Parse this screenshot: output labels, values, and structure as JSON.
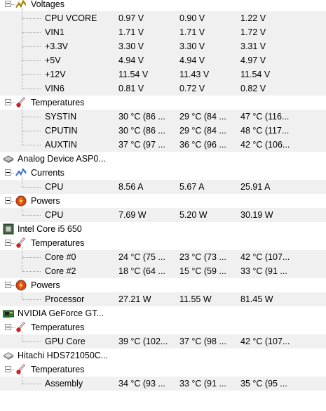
{
  "colors": {
    "row_shade": "#f0f0f0",
    "tree_line": "#a0a0a0",
    "voltage_icon": "#c8a000",
    "temperature_icon": "#cc2222",
    "current_icon": "#2a62c8",
    "power_icon": "#d94a1a"
  },
  "sections": [
    {
      "kind": "category",
      "icon": "voltage-icon",
      "label": "Voltages",
      "rows": [
        {
          "name": "CPU VCORE",
          "value": "0.97 V",
          "min": "0.90 V",
          "max": "1.22 V"
        },
        {
          "name": "VIN1",
          "value": "1.71 V",
          "min": "1.71 V",
          "max": "1.72 V"
        },
        {
          "name": "+3.3V",
          "value": "3.30 V",
          "min": "3.30 V",
          "max": "3.31 V"
        },
        {
          "name": "+5V",
          "value": "4.94 V",
          "min": "4.94 V",
          "max": "4.97 V"
        },
        {
          "name": "+12V",
          "value": "11.54 V",
          "min": "11.43 V",
          "max": "11.54 V"
        },
        {
          "name": "VIN6",
          "value": "0.81 V",
          "min": "0.72 V",
          "max": "0.82 V"
        }
      ]
    },
    {
      "kind": "category",
      "icon": "thermometer-icon",
      "label": "Temperatures",
      "rows": [
        {
          "name": "SYSTIN",
          "value": "30 °C  (86 ...",
          "min": "29 °C  (84 ...",
          "max": "47 °C  (116..."
        },
        {
          "name": "CPUTIN",
          "value": "30 °C  (86 ...",
          "min": "29 °C  (84 ...",
          "max": "48 °C  (117..."
        },
        {
          "name": "AUXTIN",
          "value": "37 °C  (97 ...",
          "min": "36 °C  (96 ...",
          "max": "42 °C  (106..."
        }
      ]
    },
    {
      "kind": "device",
      "icon": "chip-icon",
      "label": "Analog Device ASP0..."
    },
    {
      "kind": "category",
      "icon": "current-icon",
      "label": "Currents",
      "rows": [
        {
          "name": "CPU",
          "value": "8.56 A",
          "min": "5.67 A",
          "max": "25.91 A"
        }
      ]
    },
    {
      "kind": "category",
      "icon": "power-icon",
      "label": "Powers",
      "rows": [
        {
          "name": "CPU",
          "value": "7.69 W",
          "min": "5.20 W",
          "max": "30.19 W"
        }
      ]
    },
    {
      "kind": "device",
      "icon": "cpu-icon",
      "label": "Intel Core i5 650"
    },
    {
      "kind": "category",
      "icon": "thermometer-icon",
      "label": "Temperatures",
      "rows": [
        {
          "name": "Core #0",
          "value": "24 °C  (75 ...",
          "min": "23 °C  (73 ...",
          "max": "42 °C  (107..."
        },
        {
          "name": "Core #2",
          "value": "18 °C  (64 ...",
          "min": "15 °C  (59 ...",
          "max": "33 °C  (91 ..."
        }
      ]
    },
    {
      "kind": "category",
      "icon": "power-icon",
      "label": "Powers",
      "rows": [
        {
          "name": "Processor",
          "value": "27.21 W",
          "min": "11.55 W",
          "max": "81.45 W"
        }
      ]
    },
    {
      "kind": "device",
      "icon": "gpu-icon",
      "label": "NVIDIA GeForce GT..."
    },
    {
      "kind": "category",
      "icon": "thermometer-icon",
      "label": "Temperatures",
      "rows": [
        {
          "name": "GPU Core",
          "value": "39 °C  (102...",
          "min": "37 °C  (98 ...",
          "max": "42 °C  (107..."
        }
      ]
    },
    {
      "kind": "device",
      "icon": "hard-drive-icon",
      "label": "Hitachi HDS721050C..."
    },
    {
      "kind": "category",
      "icon": "thermometer-icon",
      "label": "Temperatures",
      "rows": [
        {
          "name": "Assembly",
          "value": "34 °C  (93 ...",
          "min": "33 °C  (91 ...",
          "max": "35 °C  (95 ..."
        }
      ]
    }
  ]
}
